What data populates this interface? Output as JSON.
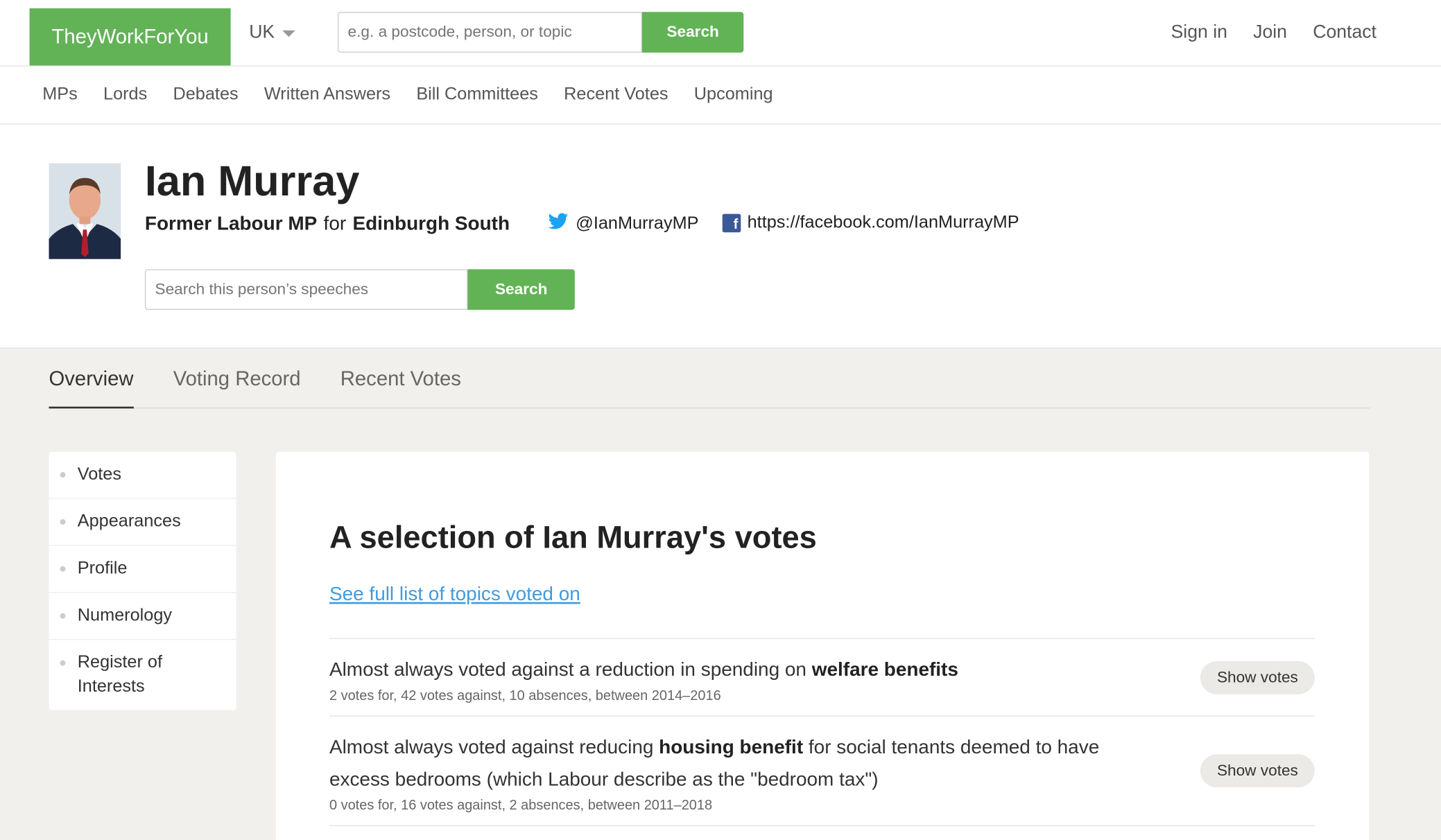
{
  "header": {
    "logo": "TheyWorkForYou",
    "country": "UK",
    "search_placeholder": "e.g. a postcode, person, or topic",
    "search_button": "Search",
    "account_links": [
      "Sign in",
      "Join",
      "Contact"
    ]
  },
  "nav": {
    "items": [
      "MPs",
      "Lords",
      "Debates",
      "Written Answers",
      "Bill Committees",
      "Recent Votes",
      "Upcoming"
    ]
  },
  "person": {
    "name": "Ian Murray",
    "role_prefix": "Former Labour MP",
    "role_for": "for",
    "constituency": "Edinburgh South",
    "twitter": "@IanMurrayMP",
    "facebook": "https://facebook.com/IanMurrayMP",
    "search_placeholder": "Search this person’s speeches",
    "search_button": "Search"
  },
  "tabs": [
    "Overview",
    "Voting Record",
    "Recent Votes"
  ],
  "sidebar": {
    "items": [
      "Votes",
      "Appearances",
      "Profile",
      "Numerology",
      "Register of Interests"
    ]
  },
  "main": {
    "heading": "A selection of Ian Murray's votes",
    "full_list_link": "See full list of topics voted on",
    "show_votes_label": "Show votes",
    "votes": [
      {
        "pre": "Almost always voted against a reduction in spending on ",
        "bold": "welfare benefits",
        "post": "",
        "meta": "2 votes for, 42 votes against, 10 absences, between 2014–2016"
      },
      {
        "pre": "Almost always voted against reducing ",
        "bold": "housing benefit",
        "post": " for social tenants deemed to have excess bedrooms (which Labour describe as the \"bedroom tax\")",
        "meta": "0 votes for, 16 votes against, 2 absences, between 2011–2018"
      }
    ]
  },
  "colors": {
    "brand_green": "#62b356",
    "link_blue": "#3e9be0",
    "background_grey": "#f1f0ec"
  }
}
